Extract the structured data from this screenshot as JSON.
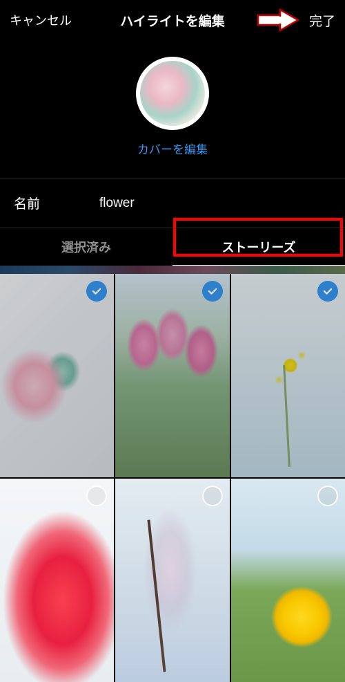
{
  "header": {
    "cancel": "キャンセル",
    "title": "ハイライトを編集",
    "done": "完了"
  },
  "cover": {
    "edit_link": "カバーを編集"
  },
  "name": {
    "label": "名前",
    "value": "flower"
  },
  "tabs": {
    "selected": "選択済み",
    "stories": "ストーリーズ"
  },
  "thumbnails": [
    {
      "id": 0,
      "selected": true,
      "desc": "pink-carnation"
    },
    {
      "id": 1,
      "selected": true,
      "desc": "pink-tulips-field"
    },
    {
      "id": 2,
      "selected": true,
      "desc": "yellow-rapeseed"
    },
    {
      "id": 3,
      "selected": false,
      "desc": "red-tulip-closeup"
    },
    {
      "id": 4,
      "selected": false,
      "desc": "cherry-blossom-branch"
    },
    {
      "id": 5,
      "selected": false,
      "desc": "sunflower"
    }
  ],
  "annotation": {
    "arrow_points_to": "done-button",
    "highlighted_tab": "stories"
  }
}
